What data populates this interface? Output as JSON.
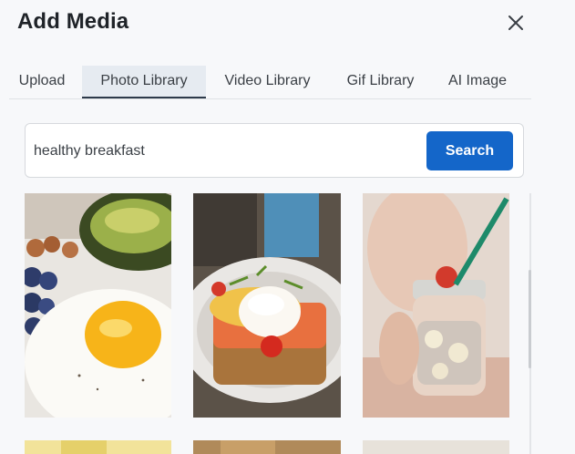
{
  "dialog": {
    "title": "Add Media"
  },
  "tabs": [
    {
      "label": "Upload"
    },
    {
      "label": "Photo Library"
    },
    {
      "label": "Video Library"
    },
    {
      "label": "Gif Library"
    },
    {
      "label": "AI Image"
    }
  ],
  "active_tab": "Photo Library",
  "search": {
    "value": "healthy breakfast",
    "button_label": "Search"
  },
  "icons": {
    "close": "close-icon"
  },
  "colors": {
    "accent": "#1466c9",
    "active_tab_bg": "#e6ebf1"
  }
}
